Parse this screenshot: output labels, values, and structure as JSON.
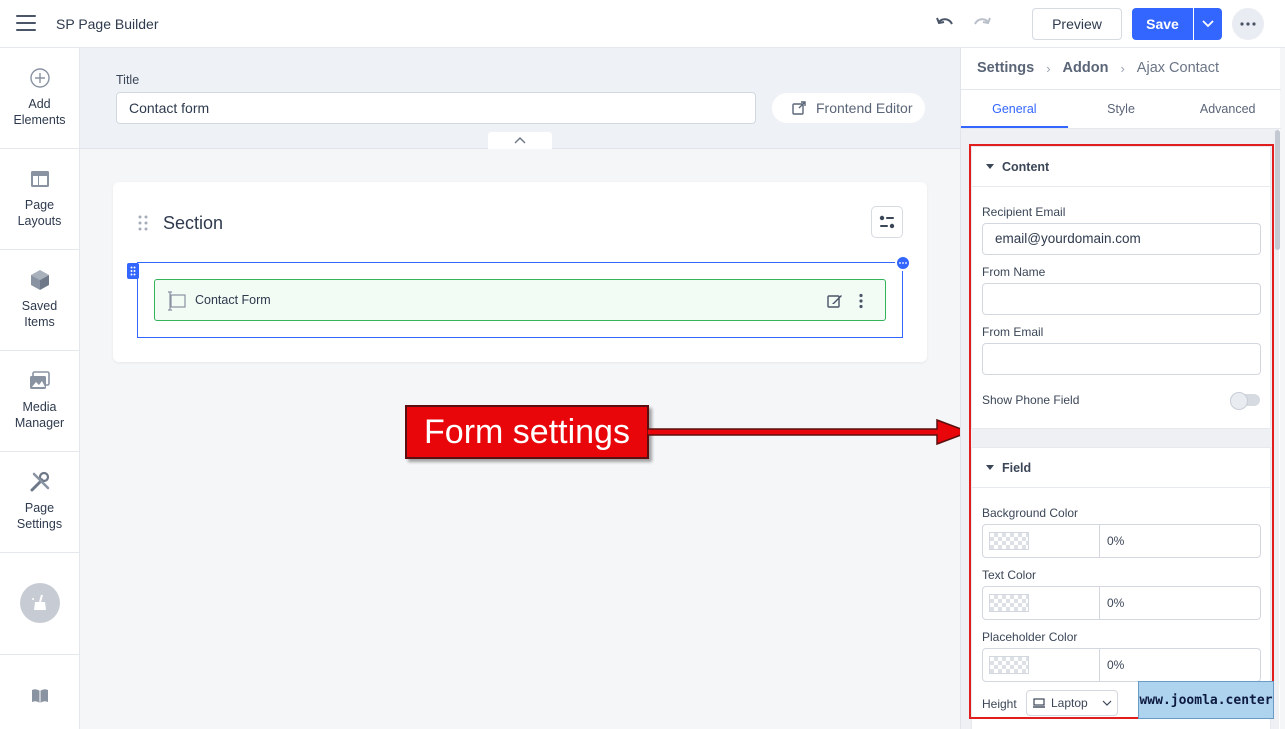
{
  "app": {
    "title": "SP Page Builder"
  },
  "toolbar": {
    "preview_label": "Preview",
    "save_label": "Save"
  },
  "sidebar": {
    "items": [
      {
        "label": "Add\nElements",
        "icon": "plus-circle-icon"
      },
      {
        "label": "Page\nLayouts",
        "icon": "layout-icon"
      },
      {
        "label": "Saved\nItems",
        "icon": "cube-icon"
      },
      {
        "label": "Media\nManager",
        "icon": "media-icon"
      },
      {
        "label": "Page\nSettings",
        "icon": "tools-icon"
      }
    ]
  },
  "title_area": {
    "label": "Title",
    "value": "Contact form",
    "frontend_editor_label": "Frontend Editor"
  },
  "canvas": {
    "section_title": "Section",
    "addon_label": "Contact Form"
  },
  "annotation": {
    "text": "Form settings",
    "color": "#e8060a"
  },
  "panel": {
    "breadcrumb": [
      "Settings",
      "Addon",
      "Ajax Contact"
    ],
    "tabs": [
      "General",
      "Style",
      "Advanced"
    ],
    "active_tab": "General",
    "content_group": {
      "title": "Content",
      "recipient_email_label": "Recipient Email",
      "recipient_email_value": "email@yourdomain.com",
      "from_name_label": "From Name",
      "from_name_value": "",
      "from_email_label": "From Email",
      "from_email_value": "",
      "show_phone_label": "Show Phone Field",
      "show_phone_on": false
    },
    "field_group": {
      "title": "Field",
      "background_color_label": "Background Color",
      "background_color_value": "0%",
      "text_color_label": "Text Color",
      "text_color_value": "0%",
      "placeholder_color_label": "Placeholder Color",
      "placeholder_color_value": "0%",
      "height_label": "Height",
      "device_value": "Laptop"
    }
  },
  "watermark": {
    "text": "www.joomla.center"
  },
  "colors": {
    "accent": "#3366ff",
    "addon_border": "#34b45a",
    "frame": "#e21d1d"
  }
}
